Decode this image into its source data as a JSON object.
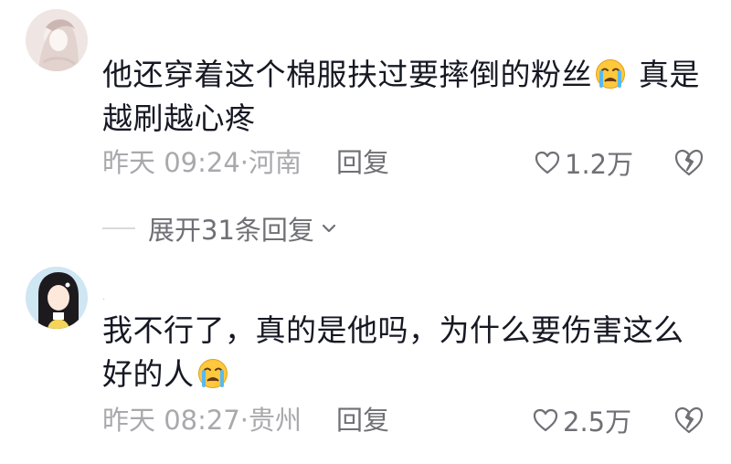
{
  "comments": [
    {
      "username": "",
      "text_before": "他还穿着这个棉服扶过要摔倒的粉丝",
      "text_after": " 真是越刷越心疼",
      "emoji": "crying-face",
      "time": "昨天 09:24",
      "location": "河南",
      "reply_label": "回复",
      "likes": "1.2万"
    },
    {
      "username": ".",
      "text_before": "我不行了，真的是他吗，为什么要伤害这么好的人",
      "text_after": "",
      "emoji": "crying-face",
      "time": "昨天 08:27",
      "location": "贵州",
      "reply_label": "回复",
      "likes": "2.5万"
    }
  ],
  "expand_replies": "展开31条回复"
}
